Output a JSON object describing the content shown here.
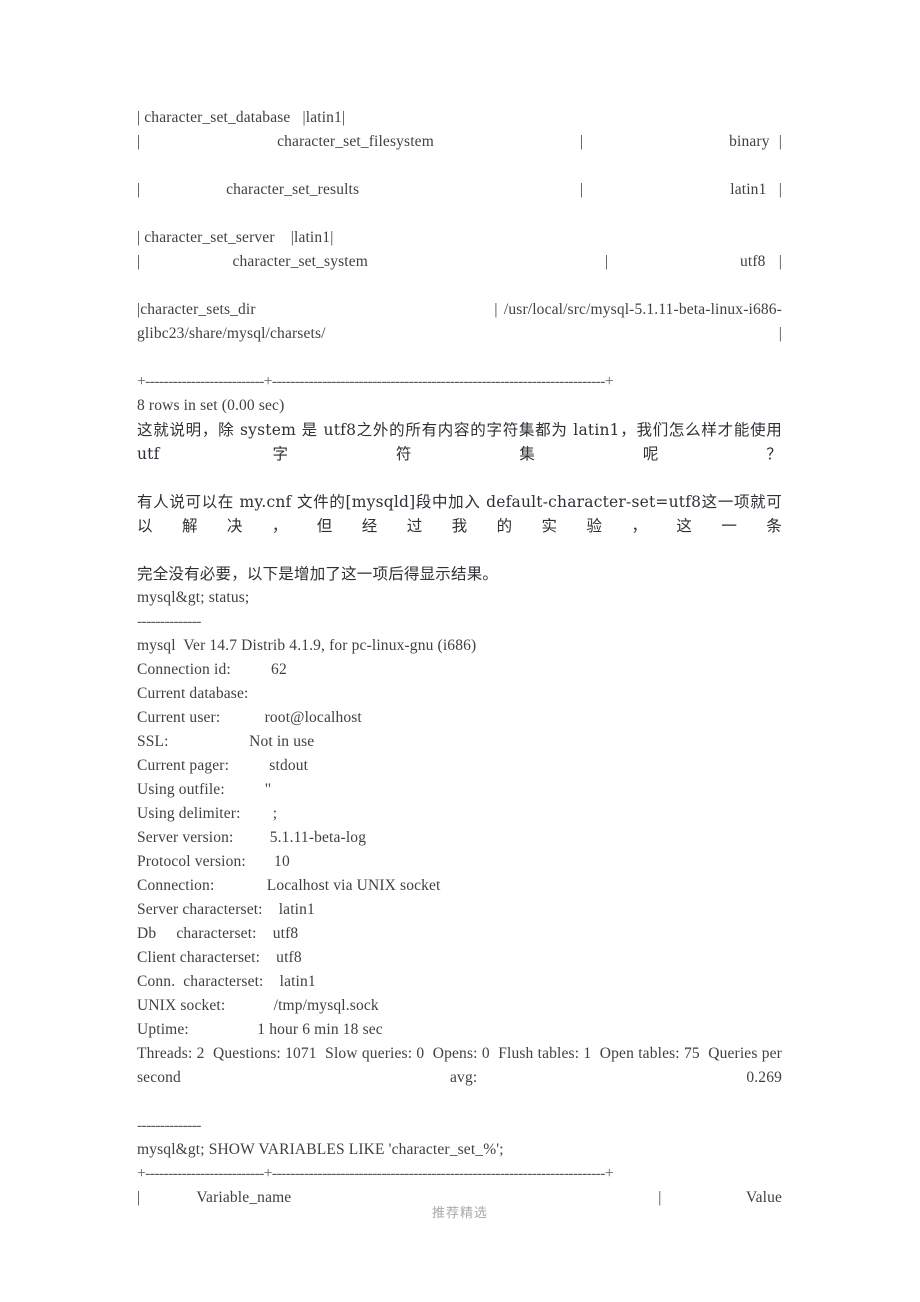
{
  "page": {
    "background_color": "#ffffff",
    "text_color": "#3f3f44",
    "watermark": "推荐精选"
  },
  "document": {
    "lines": [
      {
        "id": "row-character-set-database",
        "kind": "terminal-row",
        "justified": false,
        "text": "| character_set_database   |latin1|"
      },
      {
        "id": "row-character-set-filesystem",
        "kind": "terminal-row",
        "justified": true,
        "text": "|               character_set_filesystem                |                binary |"
      },
      {
        "id": "row-character-set-results",
        "kind": "terminal-row",
        "justified": true,
        "text": "|       character_set_results                  |            latin1 |"
      },
      {
        "id": "row-character-set-server",
        "kind": "terminal-row",
        "justified": false,
        "text": "| character_set_server    |latin1|"
      },
      {
        "id": "row-character-set-system",
        "kind": "terminal-row",
        "justified": true,
        "text": "|       character_set_system                  |          utf8 |"
      },
      {
        "id": "row-character-sets-dir",
        "kind": "terminal-row",
        "justified": true,
        "text": "|character_sets_dir                                      | /usr/local/src/mysql-5.1.11-beta-linux-i686-glibc23/share/mysql/charsets/ |"
      },
      {
        "id": "rule-top-separator",
        "kind": "rule",
        "justified": false,
        "text": "+--------------------------+-------------------------------------------------------------------------+"
      },
      {
        "id": "line-rows-in-set",
        "kind": "terminal-text",
        "justified": false,
        "text": "8 rows in set (0.00 sec)"
      },
      {
        "id": "para-explain-charsets",
        "kind": "cjk",
        "justified": true,
        "text": "这就说明，除 system 是 utf8之外的所有内容的字符集都为 latin1，我们怎么样才能使用 utf 字符集呢？"
      },
      {
        "id": "para-mycnf-advice",
        "kind": "cjk",
        "justified": true,
        "text": "有人说可以在 my.cnf 文件的[mysqld]段中加入 default-character-set=utf8这一项就可以解决，但经过我的实验，这一条"
      },
      {
        "id": "para-no-need",
        "kind": "cjk",
        "justified": false,
        "text": "完全没有必要，以下是增加了这一项后得显示结果。"
      },
      {
        "id": "prompt-status",
        "kind": "terminal-text",
        "justified": false,
        "text": "mysql&gt; status;"
      },
      {
        "id": "rule-status-top",
        "kind": "rule",
        "justified": false,
        "text": "--------------"
      },
      {
        "id": "status-version-banner",
        "kind": "terminal-text",
        "justified": false,
        "text": "mysql  Ver 14.7 Distrib 4.1.9, for pc-linux-gnu (i686)"
      },
      {
        "id": "status-connection-id",
        "kind": "terminal-text",
        "justified": false,
        "text": "Connection id:          62"
      },
      {
        "id": "status-current-database",
        "kind": "terminal-text",
        "justified": false,
        "text": "Current database:"
      },
      {
        "id": "status-current-user",
        "kind": "terminal-text",
        "justified": false,
        "text": "Current user:           root@localhost"
      },
      {
        "id": "status-ssl",
        "kind": "terminal-text",
        "justified": false,
        "text": "SSL:                    Not in use"
      },
      {
        "id": "status-current-pager",
        "kind": "terminal-text",
        "justified": false,
        "text": "Current pager:          stdout"
      },
      {
        "id": "status-using-outfile",
        "kind": "terminal-text",
        "justified": false,
        "text": "Using outfile:          ''"
      },
      {
        "id": "status-using-delimiter",
        "kind": "terminal-text",
        "justified": false,
        "text": "Using delimiter:        ;"
      },
      {
        "id": "status-server-version",
        "kind": "terminal-text",
        "justified": false,
        "text": "Server version:         5.1.11-beta-log"
      },
      {
        "id": "status-protocol-version",
        "kind": "terminal-text",
        "justified": false,
        "text": "Protocol version:       10"
      },
      {
        "id": "status-connection",
        "kind": "terminal-text",
        "justified": false,
        "text": "Connection:             Localhost via UNIX socket"
      },
      {
        "id": "status-server-characterset",
        "kind": "terminal-text",
        "justified": false,
        "text": "Server characterset:    latin1"
      },
      {
        "id": "status-db-characterset",
        "kind": "terminal-text",
        "justified": false,
        "text": "Db     characterset:    utf8"
      },
      {
        "id": "status-client-characterset",
        "kind": "terminal-text",
        "justified": false,
        "text": "Client characterset:    utf8"
      },
      {
        "id": "status-conn-characterset",
        "kind": "terminal-text",
        "justified": false,
        "text": "Conn.  characterset:    latin1"
      },
      {
        "id": "status-unix-socket",
        "kind": "terminal-text",
        "justified": false,
        "text": "UNIX socket:            /tmp/mysql.sock"
      },
      {
        "id": "status-uptime",
        "kind": "terminal-text",
        "justified": false,
        "text": "Uptime:                 1 hour 6 min 18 sec"
      },
      {
        "id": "status-counters",
        "kind": "terminal-text",
        "justified": true,
        "text": "Threads: 2  Questions: 1071  Slow queries: 0  Opens: 0  Flush tables: 1  Open tables: 75  Queries per second avg: 0.269"
      },
      {
        "id": "rule-status-bottom",
        "kind": "rule",
        "justified": false,
        "text": "--------------"
      },
      {
        "id": "prompt-show-variables",
        "kind": "terminal-text",
        "justified": false,
        "text": "mysql&gt; SHOW VARIABLES LIKE 'character_set_%';"
      },
      {
        "id": "rule-bottom-separator",
        "kind": "rule",
        "justified": false,
        "text": "+--------------------------+-------------------------------------------------------------------------+"
      },
      {
        "id": "row-table-header",
        "kind": "terminal-row",
        "justified": true,
        "text": "|    Variable_name                          |      Value"
      }
    ]
  },
  "terminal_tables": {
    "character_set_table": {
      "columns": [
        "Variable_name",
        "Value"
      ],
      "rows": [
        [
          "character_set_database",
          "latin1"
        ],
        [
          "character_set_filesystem",
          "binary"
        ],
        [
          "character_set_results",
          "latin1"
        ],
        [
          "character_set_server",
          "latin1"
        ],
        [
          "character_set_system",
          "utf8"
        ],
        [
          "character_sets_dir",
          "/usr/local/src/mysql-5.1.11-beta-linux-i686-glibc23/share/mysql/charsets/"
        ]
      ],
      "footer": "8 rows in set (0.00 sec)"
    },
    "status_output": {
      "banner": "mysql  Ver 14.7 Distrib 4.1.9, for pc-linux-gnu (i686)",
      "fields": [
        {
          "label": "Connection id:",
          "value": "62"
        },
        {
          "label": "Current database:",
          "value": ""
        },
        {
          "label": "Current user:",
          "value": "root@localhost"
        },
        {
          "label": "SSL:",
          "value": "Not in use"
        },
        {
          "label": "Current pager:",
          "value": "stdout"
        },
        {
          "label": "Using outfile:",
          "value": "''"
        },
        {
          "label": "Using delimiter:",
          "value": ";"
        },
        {
          "label": "Server version:",
          "value": "5.1.11-beta-log"
        },
        {
          "label": "Protocol version:",
          "value": "10"
        },
        {
          "label": "Connection:",
          "value": "Localhost via UNIX socket"
        },
        {
          "label": "Server characterset:",
          "value": "latin1"
        },
        {
          "label": "Db     characterset:",
          "value": "utf8"
        },
        {
          "label": "Client characterset:",
          "value": "utf8"
        },
        {
          "label": "Conn.  characterset:",
          "value": "latin1"
        },
        {
          "label": "UNIX socket:",
          "value": "/tmp/mysql.sock"
        },
        {
          "label": "Uptime:",
          "value": "1 hour 6 min 18 sec"
        }
      ],
      "counters": {
        "Threads": "2",
        "Questions": "1071",
        "Slow queries": "0",
        "Opens": "0",
        "Flush tables": "1",
        "Open tables": "75",
        "Queries per second avg": "0.269"
      }
    }
  }
}
